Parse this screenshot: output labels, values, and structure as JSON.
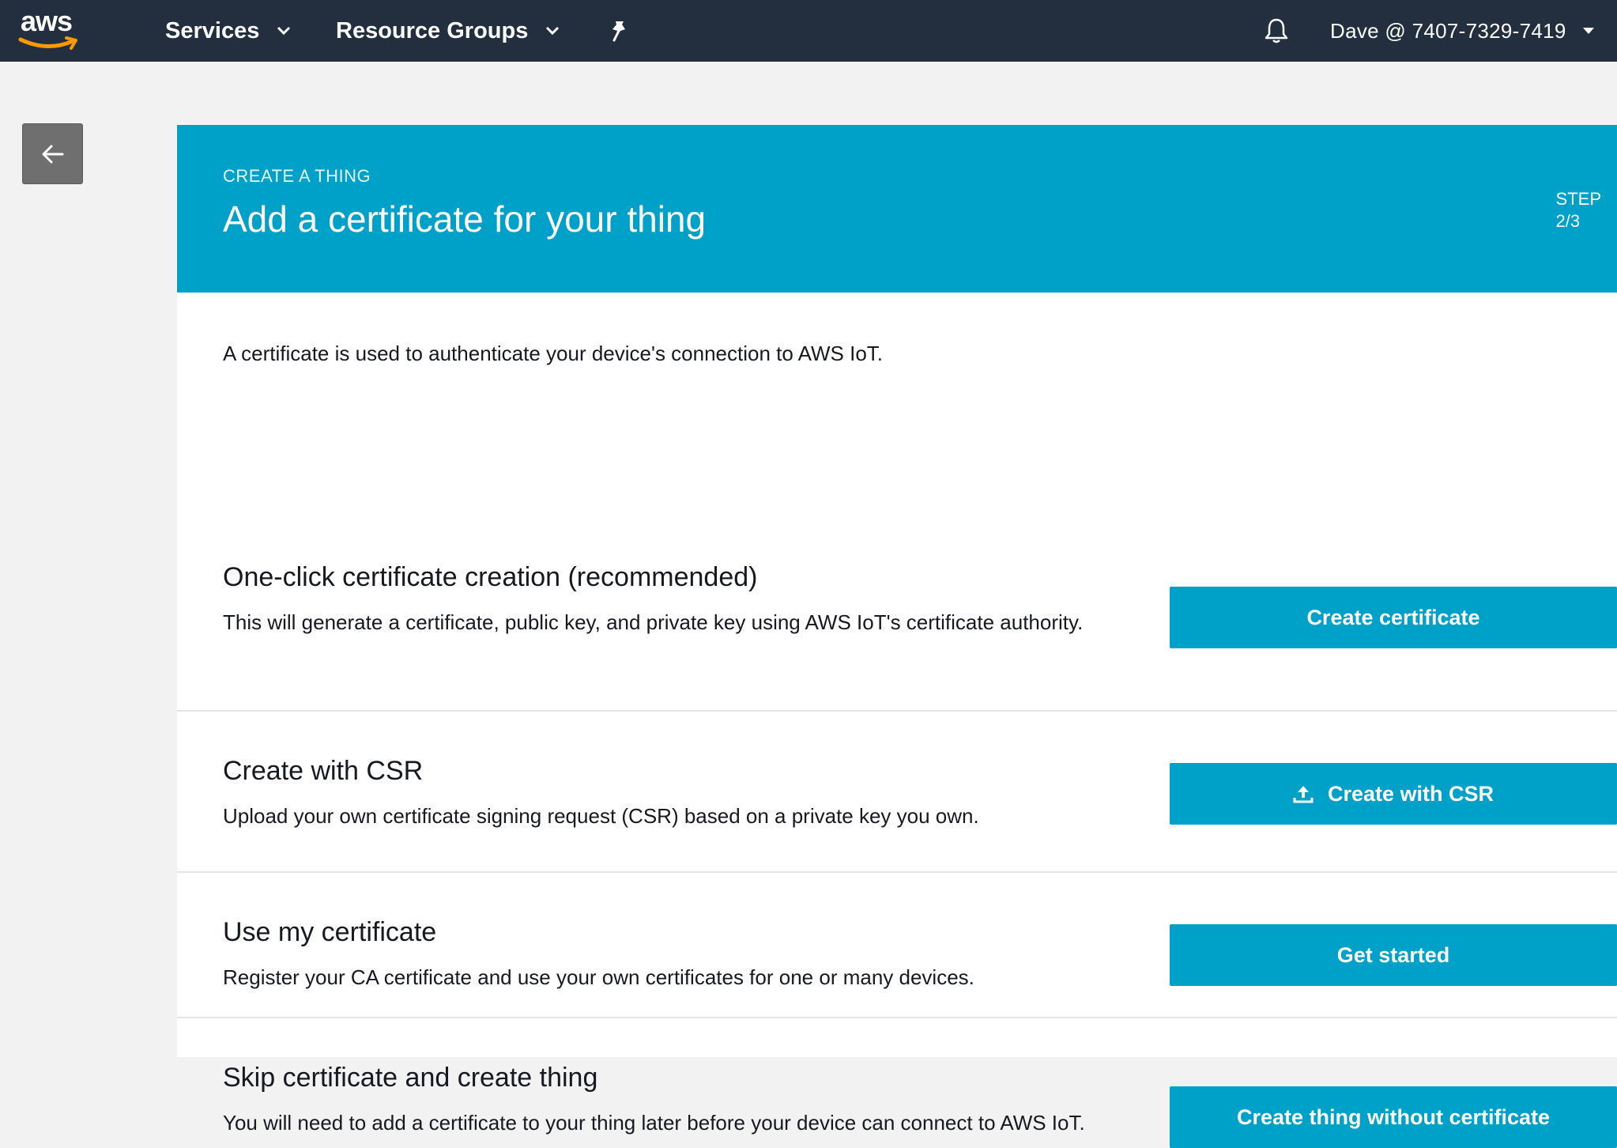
{
  "nav": {
    "logo_text": "aws",
    "services_label": "Services",
    "resource_groups_label": "Resource Groups",
    "pin_icon": "pin-icon",
    "bell_icon": "bell-icon",
    "user_label": "Dave @ 7407-7329-7419"
  },
  "header": {
    "kicker": "CREATE A THING",
    "title": "Add a certificate for your thing",
    "step_label": "STEP",
    "step_value": "2/3"
  },
  "intro": "A certificate is used to authenticate your device's connection to AWS IoT.",
  "options": [
    {
      "title": "One-click certificate creation (recommended)",
      "description": "This will generate a certificate, public key, and private key using AWS IoT's certificate authority.",
      "button": "Create certificate"
    },
    {
      "title": "Create with CSR",
      "description": "Upload your own certificate signing request (CSR) based on a private key you own.",
      "button": "Create with CSR"
    },
    {
      "title": "Use my certificate",
      "description": "Register your CA certificate and use your own certificates for one or many devices.",
      "button": "Get started"
    },
    {
      "title": "Skip certificate and create thing",
      "description": "You will need to add a certificate to your thing later before your device can connect to AWS IoT.",
      "button": "Create thing without certificate"
    }
  ],
  "colors": {
    "nav_bg": "#232f3e",
    "accent": "#00a1c9",
    "logo_smile": "#ff9900"
  }
}
